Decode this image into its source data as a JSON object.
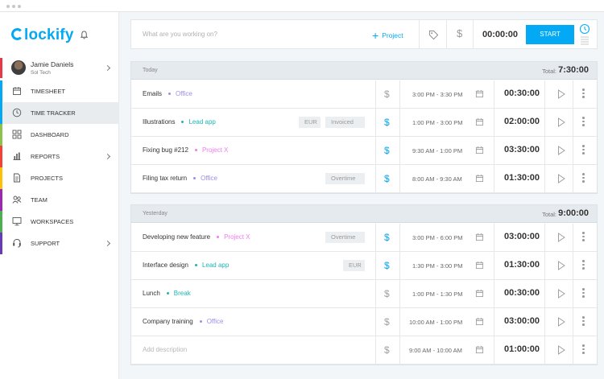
{
  "brand": {
    "name": "lockify",
    "accent": "#03a9f4"
  },
  "user": {
    "name": "Jamie Daniels",
    "org": "Sol Tech"
  },
  "sidebar": {
    "items": [
      {
        "label": "TIMESHEET",
        "icon": "calendar-icon",
        "color": "#03a9f4",
        "active": false,
        "chevron": false
      },
      {
        "label": "TIME TRACKER",
        "icon": "clock-icon",
        "color": "#03a9f4",
        "active": true,
        "chevron": false
      },
      {
        "label": "DASHBOARD",
        "icon": "grid-icon",
        "color": "#8bc34a",
        "active": false,
        "chevron": false
      },
      {
        "label": "REPORTS",
        "icon": "bar-chart-icon",
        "color": "#f44336",
        "active": false,
        "chevron": true
      },
      {
        "label": "PROJECTS",
        "icon": "document-icon",
        "color": "#ffc107",
        "active": false,
        "chevron": false
      },
      {
        "label": "TEAM",
        "icon": "team-icon",
        "color": "#9c27b0",
        "active": false,
        "chevron": false
      },
      {
        "label": "WORKSPACES",
        "icon": "monitor-icon",
        "color": "#4caf50",
        "active": false,
        "chevron": false
      },
      {
        "label": "SUPPORT",
        "icon": "headset-icon",
        "color": "#673ab7",
        "active": false,
        "chevron": true
      }
    ]
  },
  "timer": {
    "placeholder": "What are you working on?",
    "project_label": "Project",
    "time": "00:00:00",
    "start_label": "START"
  },
  "groups": [
    {
      "day": "Today",
      "total_label": "Total:",
      "total": "7:30:00",
      "entries": [
        {
          "description": "Emails",
          "project": "Office",
          "project_color": "#9b8fe8",
          "tags": [],
          "billable": false,
          "range": "3:00 PM - 3:30 PM",
          "duration": "00:30:00"
        },
        {
          "description": "Illustrations",
          "project": "Lead app",
          "project_color": "#1fb5b5",
          "tags": [
            "EUR",
            "Invoiced"
          ],
          "billable": true,
          "range": "1:00 PM - 3:00 PM",
          "duration": "02:00:00"
        },
        {
          "description": "Fixing bug #212",
          "project": "Project X",
          "project_color": "#ef7cf0",
          "tags": [],
          "billable": true,
          "range": "9:30 AM - 1:00 PM",
          "duration": "03:30:00"
        },
        {
          "description": "Filing tax return",
          "project": "Office",
          "project_color": "#9b8fe8",
          "tags": [
            "Overtime"
          ],
          "billable": true,
          "range": "8:00 AM - 9:30 AM",
          "duration": "01:30:00"
        }
      ]
    },
    {
      "day": "Yesterday",
      "total_label": "Total:",
      "total": "9:00:00",
      "entries": [
        {
          "description": "Developing new feature",
          "project": "Project X",
          "project_color": "#ef7cf0",
          "tags": [
            "Overtime"
          ],
          "billable": true,
          "range": "3:00 PM - 6:00 PM",
          "duration": "03:00:00"
        },
        {
          "description": "Interface design",
          "project": "Lead app",
          "project_color": "#1fb5b5",
          "tags": [
            "EUR"
          ],
          "billable": true,
          "range": "1:30 PM - 3:00 PM",
          "duration": "01:30:00"
        },
        {
          "description": "Lunch",
          "project": "Break",
          "project_color": "#1fb5b5",
          "tags": [],
          "billable": false,
          "range": "1:00 PM - 1:30 PM",
          "duration": "00:30:00"
        },
        {
          "description": "Company training",
          "project": "Office",
          "project_color": "#9b8fe8",
          "tags": [],
          "billable": false,
          "range": "10:00 AM - 1:00 PM",
          "duration": "03:00:00"
        },
        {
          "description": "Add description",
          "project": "",
          "project_color": "",
          "tags": [],
          "billable": false,
          "range": "9:00 AM - 10:00 AM",
          "duration": "01:00:00",
          "placeholder": true
        }
      ]
    }
  ]
}
